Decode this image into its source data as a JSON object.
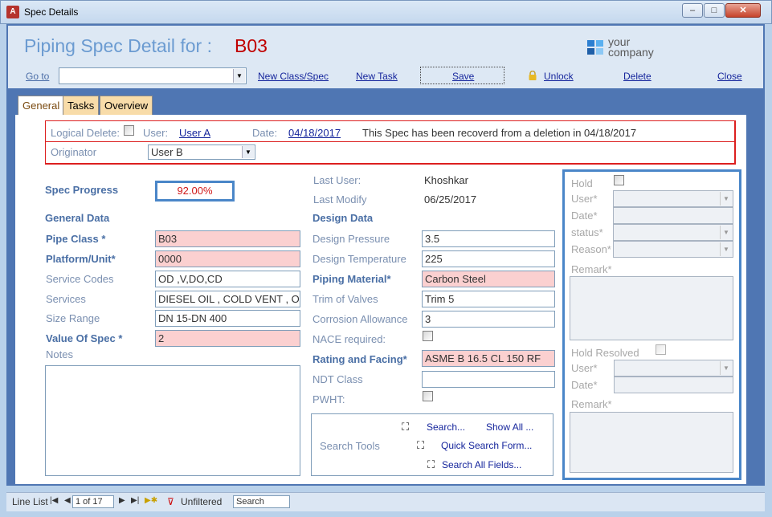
{
  "window": {
    "title": "Spec Details",
    "app_icon": "A",
    "minimize": "–",
    "maximize": "□",
    "close": "✕"
  },
  "header": {
    "title": "Piping Spec Detail for :",
    "spec_id": "B03",
    "logo_line1": "your",
    "logo_line2": "company",
    "logo_colors": [
      "#2c7fd1",
      "#5ab0f0",
      "#1f5fa8",
      "#8cc8f5"
    ]
  },
  "toolbar": {
    "goto_label": "Go to",
    "goto_value": "",
    "new_class_spec": "New Class/Spec",
    "new_task": "New Task",
    "save": "Save",
    "unlock": "Unlock",
    "delete": "Delete",
    "close": "Close"
  },
  "tabs": [
    {
      "label": "General"
    },
    {
      "label": "Tasks"
    },
    {
      "label": "Overview"
    }
  ],
  "logical": {
    "logical_delete_label": "Logical Delete:",
    "user_label": "User:",
    "user_value": "User A",
    "date_label": "Date:",
    "date_value": "04/18/2017",
    "message": "This Spec has been recoverd from a deletion in 04/18/2017",
    "originator_label": "Originator",
    "originator_value": "User B"
  },
  "general": {
    "spec_progress_label": "Spec Progress",
    "spec_progress_value": "92.00%",
    "section_title": "General Data",
    "pipe_class_label": "Pipe Class *",
    "pipe_class_value": "B03",
    "platform_label": "Platform/Unit*",
    "platform_value": "0000",
    "service_codes_label": "Service Codes",
    "service_codes_value": "OD ,V,DO,CD",
    "services_label": "Services",
    "services_value": "DIESEL OIL , COLD VENT , O",
    "size_range_label": "Size Range",
    "size_range_value": "DN 15-DN 400",
    "value_of_spec_label": "Value Of Spec *",
    "value_of_spec_value": "2",
    "notes_label": "Notes",
    "notes_value": ""
  },
  "design": {
    "last_user_label": "Last User:",
    "last_user_value": "Khoshkar",
    "last_modify_label": "Last Modify",
    "last_modify_value": "06/25/2017",
    "section_title": "Design Data",
    "pressure_label": "Design Pressure",
    "pressure_value": "3.5",
    "temperature_label": "Design Temperature",
    "temperature_value": "225",
    "material_label": "Piping Material*",
    "material_value": "Carbon Steel",
    "trim_label": "Trim of Valves",
    "trim_value": "Trim 5",
    "corrosion_label": "Corrosion Allowance",
    "corrosion_value": "3",
    "nace_label": "NACE required:",
    "rating_label": "Rating and Facing*",
    "rating_value": "ASME B 16.5 CL 150 RF",
    "ndt_label": "NDT Class",
    "ndt_value": "",
    "pwht_label": "PWHT:"
  },
  "search_tools": {
    "label": "Search Tools",
    "search": "Search...",
    "show_all": "Show All ...",
    "quick_search": "Quick Search Form...",
    "search_all_fields": "Search All Fields..."
  },
  "hold": {
    "hold_label": "Hold",
    "user_label": "User*",
    "date_label": "Date*",
    "status_label": "status*",
    "reason_label": "Reason*",
    "remark_label": "Remark*",
    "resolved_label": "Hold Resolved",
    "resolved_user_label": "User*",
    "resolved_date_label": "Date*",
    "resolved_remark_label": "Remark*"
  },
  "statusbar": {
    "line_list": "Line List",
    "record": "1 of 17",
    "filter": "Unfiltered",
    "search": "Search"
  }
}
